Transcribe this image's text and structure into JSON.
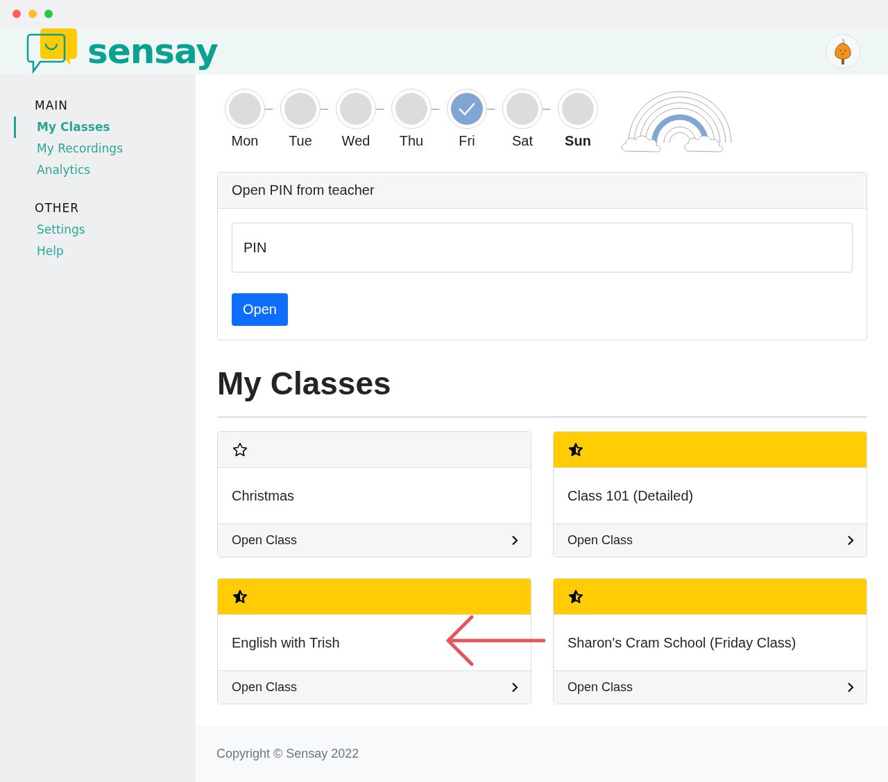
{
  "header": {
    "logo_text": "sensay"
  },
  "sidebar": {
    "sections": [
      {
        "title": "MAIN",
        "items": [
          {
            "label": "My Classes",
            "selected": true
          },
          {
            "label": "My Recordings",
            "selected": false
          },
          {
            "label": "Analytics",
            "selected": false
          }
        ]
      },
      {
        "title": "OTHER",
        "items": [
          {
            "label": "Settings",
            "selected": false
          },
          {
            "label": "Help",
            "selected": false
          }
        ]
      }
    ]
  },
  "week": [
    {
      "label": "Mon",
      "done": false,
      "today": false
    },
    {
      "label": "Tue",
      "done": false,
      "today": false
    },
    {
      "label": "Wed",
      "done": false,
      "today": false
    },
    {
      "label": "Thu",
      "done": false,
      "today": false
    },
    {
      "label": "Fri",
      "done": true,
      "today": false
    },
    {
      "label": "Sat",
      "done": false,
      "today": false
    },
    {
      "label": "Sun",
      "done": false,
      "today": true
    }
  ],
  "pin_card": {
    "title": "Open PIN from teacher",
    "placeholder": "PIN",
    "button": "Open"
  },
  "heading": "My Classes",
  "classes": [
    {
      "name": "Christmas",
      "favorite": false,
      "action": "Open Class"
    },
    {
      "name": "Class 101 (Detailed)",
      "favorite": true,
      "action": "Open Class"
    },
    {
      "name": "English with Trish",
      "favorite": true,
      "action": "Open Class"
    },
    {
      "name": "Sharon's Cram School (Friday Class)",
      "favorite": true,
      "action": "Open Class"
    }
  ],
  "footer": "Copyright © Sensay 2022"
}
